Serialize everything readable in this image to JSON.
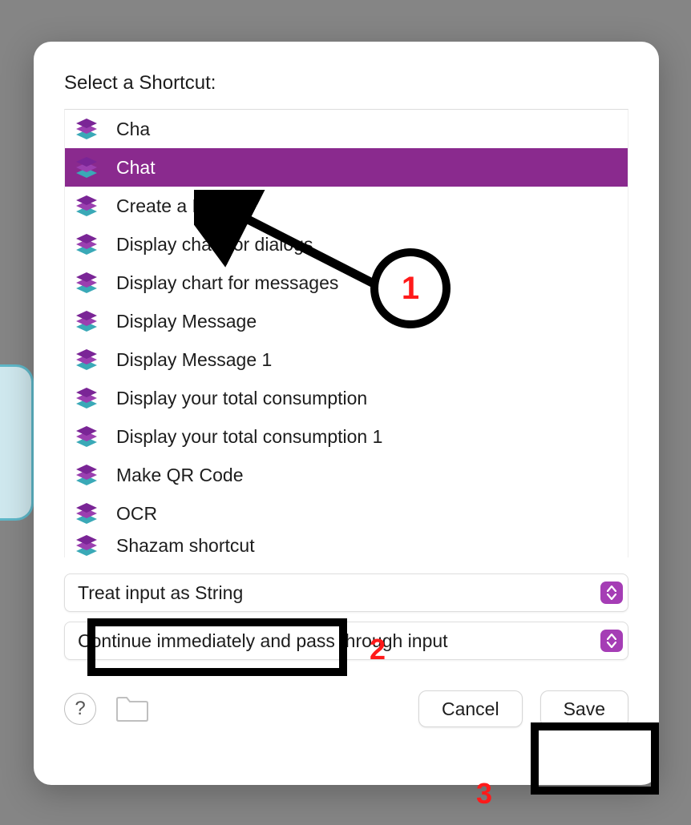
{
  "dialog": {
    "title": "Select a Shortcut:",
    "shortcuts": [
      {
        "label": "Cha",
        "selected": false
      },
      {
        "label": "Chat",
        "selected": true
      },
      {
        "label": "Create a Prompt",
        "selected": false
      },
      {
        "label": "Display chart for dialogs",
        "selected": false
      },
      {
        "label": "Display chart for messages",
        "selected": false
      },
      {
        "label": "Display Message",
        "selected": false
      },
      {
        "label": "Display Message 1",
        "selected": false
      },
      {
        "label": "Display your total consumption",
        "selected": false
      },
      {
        "label": "Display your total consumption 1",
        "selected": false
      },
      {
        "label": "Make QR Code",
        "selected": false
      },
      {
        "label": "OCR",
        "selected": false
      },
      {
        "label": "Shazam shortcut",
        "selected": false
      }
    ],
    "select1": "Treat input as String",
    "select2": "Continue immediately and pass through input",
    "help_label": "?",
    "cancel_label": "Cancel",
    "save_label": "Save"
  },
  "annotations": {
    "n1": "1",
    "n2": "2",
    "n3": "3"
  },
  "colors": {
    "selection": "#8a2a8e",
    "accent": "#a53db5",
    "annot_red": "#ff1a1a"
  }
}
